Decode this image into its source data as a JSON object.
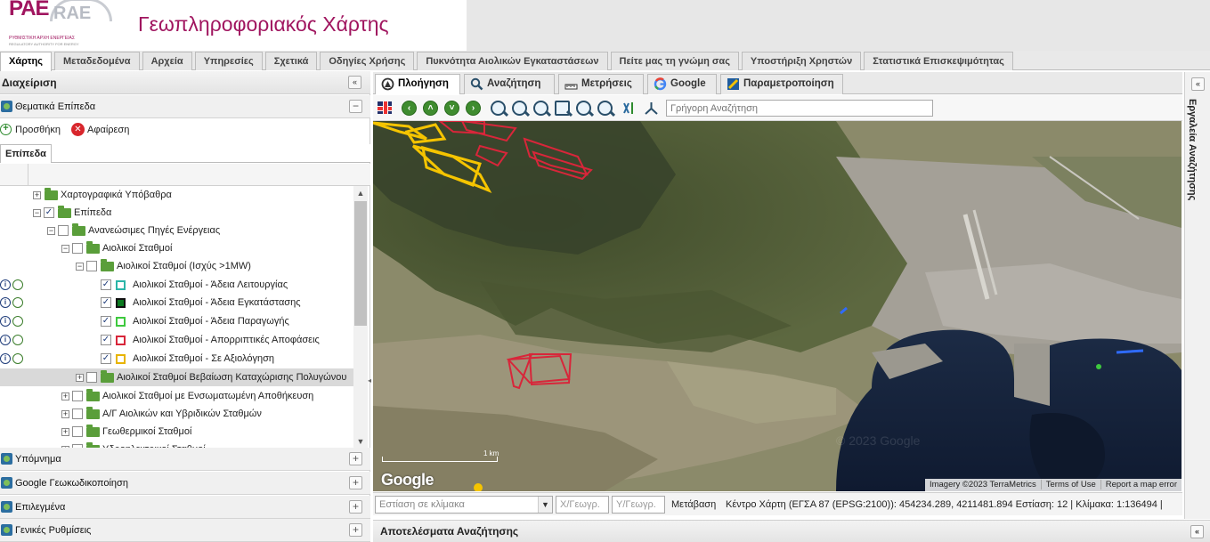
{
  "header": {
    "logo_main": "PAE",
    "logo_alt": "RAE",
    "logo_sub1": "ΡΥΘΜΙΣΤΙΚΗ ΑΡΧΗ ΕΝΕΡΓΕΙΑΣ",
    "logo_sub2": "REGULATORY AUTHORITY FOR ENERGY",
    "title": "Γεωπληροφοριακός Χάρτης"
  },
  "main_tabs": [
    {
      "label": "Χάρτης",
      "active": true
    },
    {
      "label": "Μεταδεδομένα"
    },
    {
      "label": "Αρχεία"
    },
    {
      "label": "Υπηρεσίες"
    },
    {
      "label": "Σχετικά"
    },
    {
      "label": "Οδηγίες Χρήσης"
    },
    {
      "label": "Πυκνότητα Αιολικών Εγκαταστάσεων"
    },
    {
      "label": "Πείτε μας τη γνώμη σας"
    },
    {
      "label": "Υποστήριξη Χρηστών"
    },
    {
      "label": "Στατιστικά Επισκεψιμότητας"
    }
  ],
  "left_panel": {
    "title": "Διαχείριση",
    "collapse": "«",
    "thematic": "Θεματικά Επίπεδα",
    "add": "Προσθήκη",
    "remove": "Αφαίρεση",
    "sub_tab": "Επίπεδα",
    "tree": [
      {
        "label": "Χαρτογραφικά Υπόβαθρα",
        "expander": "+",
        "checked": null
      },
      {
        "label": "Επίπεδα",
        "expander": "−",
        "checked": true
      },
      {
        "label": "Ανανεώσιμες Πηγές Ενέργειας",
        "expander": "−",
        "checked": false
      },
      {
        "label": "Αιολικοί Σταθμοί",
        "expander": "−",
        "checked": false
      },
      {
        "label": "Αιολικοί Σταθμοί (Ισχύς >1MW)",
        "expander": "−",
        "checked": false
      },
      {
        "label": "Αιολικοί Σταθμοί - Άδεια Λειτουργίας",
        "checked": true,
        "legend_color": "#2bb5a8"
      },
      {
        "label": "Αιολικοί Σταθμοί - Άδεια Εγκατάστασης",
        "checked": true,
        "legend_color": "#0a7a1f"
      },
      {
        "label": "Αιολικοί Σταθμοί - Άδεια Παραγωγής",
        "checked": true,
        "legend_color": "#3ec93e"
      },
      {
        "label": "Αιολικοί Σταθμοί - Απορριπτικές Αποφάσεις",
        "checked": true,
        "legend_color": "#d8263a"
      },
      {
        "label": "Αιολικοί Σταθμοί - Σε Αξιολόγηση",
        "checked": true,
        "legend_color": "#e8b400"
      },
      {
        "label": "Αιολικοί Σταθμοί Βεβαίωση Καταχώρισης Πολυγώνου",
        "expander": "+",
        "checked": false
      },
      {
        "label": "Αιολικοί Σταθμοί με Ενσωματωμένη Αποθήκευση",
        "expander": "+",
        "checked": false
      },
      {
        "label": "Α/Γ Αιολικών και Υβριδικών Σταθμών",
        "expander": "+",
        "checked": false
      },
      {
        "label": "Γεωθερμικοί Σταθμοί",
        "expander": "+",
        "checked": false
      },
      {
        "label": "Υδροηλεκτρικοί Σταθμοί",
        "expander": "+",
        "checked": false
      }
    ],
    "accordion": [
      "Υπόμνημα",
      "Google Γεωκωδικοποίηση",
      "Επιλεγμένα",
      "Γενικές Ρυθμίσεις"
    ],
    "accordion_btn": "+"
  },
  "map_tabs": [
    {
      "label": "Πλοήγηση",
      "active": true,
      "icon": "navigation-icon"
    },
    {
      "label": "Αναζήτηση",
      "icon": "search-icon"
    },
    {
      "label": "Μετρήσεις",
      "icon": "ruler-icon"
    },
    {
      "label": "Google",
      "icon": "google-icon"
    },
    {
      "label": "Παραμετροποίηση",
      "icon": "settings-icon"
    }
  ],
  "toolbar": {
    "quick_search_placeholder": "Γρήγορη Αναζήτηση"
  },
  "map": {
    "attribution": [
      "Imagery ©2023 TerraMetrics",
      "Terms of Use",
      "Report a map error"
    ],
    "google": "Google",
    "scale": "1 km"
  },
  "statusbar": {
    "scale_placeholder": "Εστίαση σε κλίμακα",
    "x_placeholder": "Χ/Γεωγρ.",
    "y_placeholder": "Υ/Γεωγρ.",
    "go": "Μετάβαση",
    "info": "Κέντρο Χάρτη (ΕΓΣΑ 87 (EPSG:2100)): 454234.289, 4211481.894 Εστίαση: 12 | Κλίμακα: 1:136494 |"
  },
  "results": {
    "title": "Αποτελέσματα Αναζήτησης",
    "btn": "«"
  },
  "east_panel": {
    "title": "Εργαλεία Αναζήτησης",
    "btn": "«"
  },
  "colors": {
    "brand": "#a0155f",
    "candidate": "#e8b400",
    "rejected": "#d8263a"
  }
}
